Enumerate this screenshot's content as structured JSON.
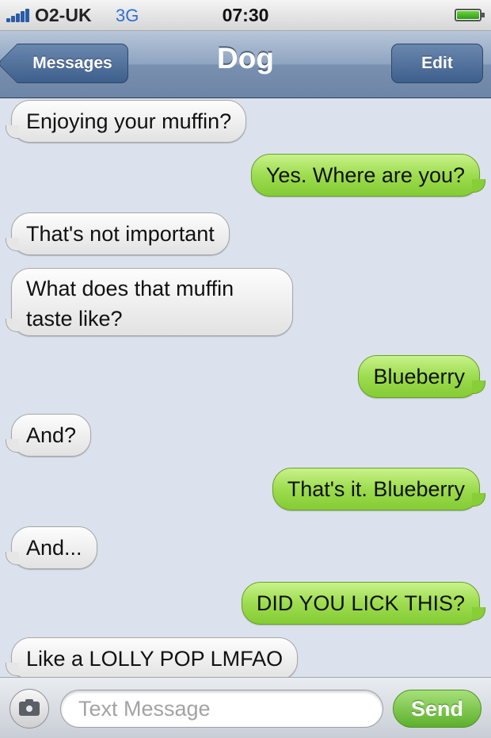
{
  "status_bar": {
    "carrier": "O2-UK",
    "network": "3G",
    "time": "07:30",
    "battery_level": 1.0
  },
  "nav": {
    "back_label": "Messages",
    "title": "Dog",
    "edit_label": "Edit"
  },
  "messages": [
    {
      "from": "them",
      "text": "Enjoying your muffin?"
    },
    {
      "from": "me",
      "text": "Yes. Where are you?"
    },
    {
      "from": "them",
      "text": "That's not important"
    },
    {
      "from": "them",
      "text": "What does that muffin taste like?"
    },
    {
      "from": "me",
      "text": "Blueberry"
    },
    {
      "from": "them",
      "text": "And?"
    },
    {
      "from": "me",
      "text": "That's it. Blueberry"
    },
    {
      "from": "them",
      "text": "And..."
    },
    {
      "from": "me",
      "text": "DID YOU LICK THIS?"
    },
    {
      "from": "them",
      "text": "Like a LOLLY POP LMFAO"
    }
  ],
  "composer": {
    "placeholder": "Text Message",
    "send_label": "Send",
    "camera_icon": "camera-icon"
  },
  "colors": {
    "incoming_bubble": "#e6e6e6",
    "outgoing_bubble": "#9ddc4f",
    "nav_bar": "#8ea4c0",
    "background": "#dbe2ed"
  }
}
